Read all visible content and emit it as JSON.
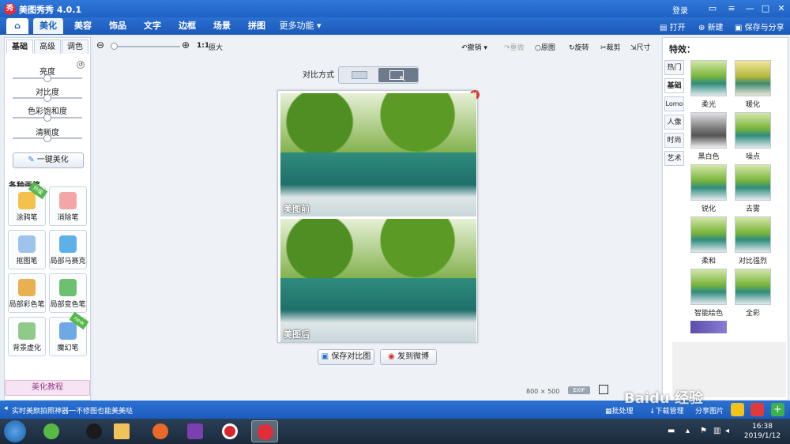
{
  "window": {
    "title": "美图秀秀 4.0.1",
    "login": "登录",
    "app_icon": "秀"
  },
  "nav": {
    "tabs": [
      "美化",
      "美容",
      "饰品",
      "文字",
      "边框",
      "场景",
      "拼图",
      "更多功能"
    ],
    "active_tab": "美化",
    "actions": {
      "open": "打开",
      "new": "新建",
      "save_share": "保存与分享"
    }
  },
  "left": {
    "tabs": [
      "基础",
      "高级",
      "调色"
    ],
    "active_tab": "基础",
    "sliders": [
      {
        "label": "亮度",
        "value": 0.5
      },
      {
        "label": "对比度",
        "value": 0.5
      },
      {
        "label": "色彩饱和度",
        "value": 0.5
      },
      {
        "label": "清晰度",
        "value": 0.5
      }
    ],
    "one_key": "一键美化",
    "brush_header": "各种画笔",
    "brushes": [
      {
        "label": "涂鸦笔",
        "badge": "升级"
      },
      {
        "label": "消除笔",
        "badge": ""
      },
      {
        "label": "抠图笔",
        "badge": ""
      },
      {
        "label": "局部马赛克",
        "badge": ""
      },
      {
        "label": "局部彩色笔",
        "badge": ""
      },
      {
        "label": "局部变色笔",
        "badge": ""
      },
      {
        "label": "背景虚化",
        "badge": ""
      },
      {
        "label": "魔幻笔",
        "badge": "new"
      }
    ],
    "tutorial": "美化教程"
  },
  "toolbar": {
    "zoom_ratio": "1:1",
    "zoom_fit": "原大",
    "undo": "撤销",
    "redo": "重做",
    "original": "原图",
    "rotate": "旋转",
    "crop": "裁剪",
    "size": "尺寸"
  },
  "compare": {
    "label": "对比方式",
    "before": "美图前",
    "after": "美图后",
    "save_btn": "保存对比图",
    "weibo_btn": "发到微博"
  },
  "image_info": {
    "width": "800",
    "x": "×",
    "height": "500",
    "exif": "EXIF"
  },
  "right": {
    "header": "特效：",
    "categories": [
      "热门",
      "基础",
      "Lomo",
      "人像",
      "时尚",
      "艺术"
    ],
    "active_category": "基础",
    "effects": [
      "柔光",
      "暖化",
      "黑白色",
      "噪点",
      "锐化",
      "去雾",
      "柔和",
      "对比强烈",
      "智能绘色",
      "全彩"
    ]
  },
  "status": {
    "message": "实时美颜拍照神器一不修图也能美美哒",
    "batch": "批处理",
    "download": "下载管理",
    "share": "分享图片"
  },
  "taskbar": {
    "time": "16:38",
    "date": "2019/1/12"
  },
  "watermark": "Baidu 经验"
}
